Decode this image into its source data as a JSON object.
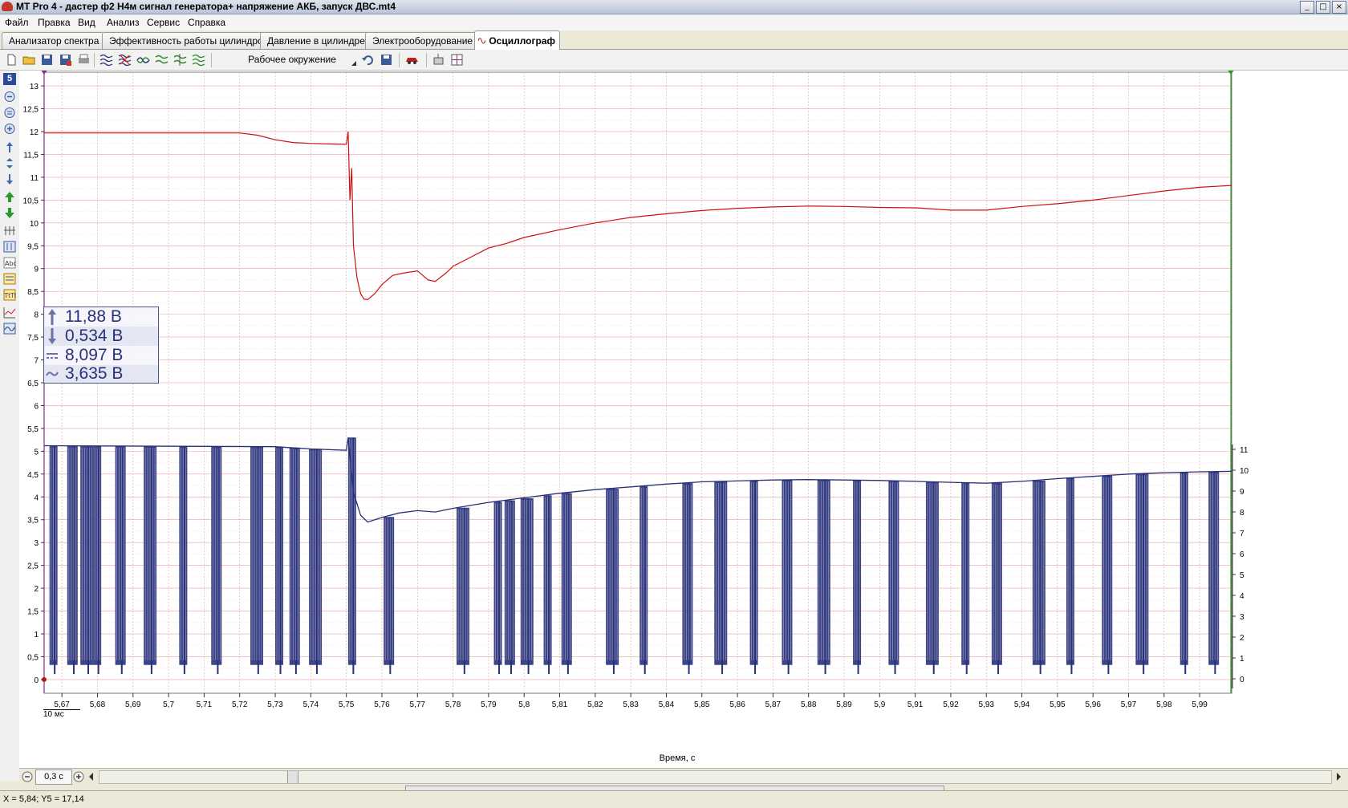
{
  "window": {
    "title": "MT Pro 4 - дастер ф2 Н4м сигнал генератора+ напряжение АКБ, запуск ДВС.mt4",
    "minimize": "_",
    "maximize": "□",
    "close": "×"
  },
  "menu": [
    "Файл",
    "Правка",
    "Вид",
    "Анализ",
    "Сервис",
    "Справка"
  ],
  "tabs": [
    {
      "label": "Анализатор спектра",
      "icon": "spectrum-icon",
      "active": false
    },
    {
      "label": "Эффективность работы цилиндров",
      "icon": "gears-icon",
      "active": false
    },
    {
      "label": "Давление в цилиндре",
      "icon": "pressure-icon",
      "active": false
    },
    {
      "label": "Электрооборудование",
      "icon": "electrical-icon",
      "active": false
    },
    {
      "label": "Осциллограф",
      "icon": "oscilloscope-icon",
      "active": true
    }
  ],
  "toolbar": {
    "workspace_label": "Рабочее окружение"
  },
  "left_toolbar": {
    "channel_badge": "5"
  },
  "measurements": [
    {
      "icon": "max-arrow-icon",
      "value": "11,88 В"
    },
    {
      "icon": "min-arrow-icon",
      "value": "0,534 В"
    },
    {
      "icon": "dc-average-icon",
      "value": "8,097 В"
    },
    {
      "icon": "ac-tilde-icon",
      "value": "3,635 В"
    }
  ],
  "bottom": {
    "scale_label": "10 мс",
    "zoom_value": "0,3 с",
    "status": "X = 5,84; Y5 = 17,14"
  },
  "chart_data": {
    "type": "line",
    "xlabel": "Время, с",
    "xlim": [
      5.665,
      5.999
    ],
    "x_ticks": [
      "5,67",
      "5,68",
      "5,69",
      "5,7",
      "5,71",
      "5,72",
      "5,73",
      "5,74",
      "5,75",
      "5,76",
      "5,77",
      "5,78",
      "5,79",
      "5,8",
      "5,81",
      "5,82",
      "5,83",
      "5,84",
      "5,85",
      "5,86",
      "5,87",
      "5,88",
      "5,89",
      "5,9",
      "5,91",
      "5,92",
      "5,93",
      "5,94",
      "5,95",
      "5,96",
      "5,97",
      "5,98",
      "5,99"
    ],
    "left_axis": {
      "ylim": [
        -0.3,
        13.3
      ],
      "ticks": [
        "0",
        "0,5",
        "1",
        "1,5",
        "2",
        "2,5",
        "3",
        "3,5",
        "4",
        "4,5",
        "5",
        "5,5",
        "6",
        "6,5",
        "7",
        "7,5",
        "8",
        "8,5",
        "9",
        "9,5",
        "10",
        "10,5",
        "11",
        "11,5",
        "12",
        "12,5",
        "13"
      ]
    },
    "right_axis": {
      "ticks": [
        "0",
        "1",
        "2",
        "3",
        "4",
        "5",
        "6",
        "7",
        "8",
        "9",
        "10",
        "11"
      ]
    },
    "grid": true,
    "colors": {
      "battery": "#cc1111",
      "generator": "#28307a",
      "grid": "#e8a0a0"
    },
    "series": [
      {
        "color": "#cc1111",
        "x": [
          5.665,
          5.72,
          5.725,
          5.73,
          5.735,
          5.74,
          5.75,
          5.7505,
          5.751,
          5.7515,
          5.752,
          5.753,
          5.754,
          5.755,
          5.756,
          5.758,
          5.76,
          5.763,
          5.766,
          5.77,
          5.773,
          5.775,
          5.778,
          5.78,
          5.785,
          5.79,
          5.795,
          5.8,
          5.81,
          5.82,
          5.83,
          5.84,
          5.85,
          5.86,
          5.87,
          5.88,
          5.89,
          5.9,
          5.91,
          5.92,
          5.93,
          5.94,
          5.95,
          5.96,
          5.97,
          5.98,
          5.99,
          5.999
        ],
        "y": [
          11.97,
          11.97,
          11.92,
          11.82,
          11.76,
          11.74,
          11.72,
          12.0,
          10.5,
          11.2,
          9.5,
          8.8,
          8.45,
          8.33,
          8.32,
          8.45,
          8.65,
          8.85,
          8.9,
          8.95,
          8.75,
          8.72,
          8.9,
          9.05,
          9.25,
          9.45,
          9.55,
          9.68,
          9.85,
          10.0,
          10.12,
          10.2,
          10.27,
          10.32,
          10.35,
          10.37,
          10.36,
          10.34,
          10.33,
          10.28,
          10.28,
          10.36,
          10.42,
          10.5,
          10.6,
          10.7,
          10.78,
          10.82
        ]
      },
      {
        "color": "#28307a",
        "x": [
          5.665,
          5.73,
          5.74,
          5.75,
          5.7505,
          5.751,
          5.752,
          5.754,
          5.756,
          5.76,
          5.765,
          5.77,
          5.775,
          5.78,
          5.79,
          5.8,
          5.81,
          5.82,
          5.83,
          5.84,
          5.85,
          5.86,
          5.87,
          5.88,
          5.89,
          5.9,
          5.91,
          5.92,
          5.93,
          5.94,
          5.95,
          5.96,
          5.97,
          5.98,
          5.99,
          5.999
        ],
        "y": [
          5.12,
          5.1,
          5.05,
          5.02,
          5.3,
          4.9,
          4.1,
          3.6,
          3.45,
          3.55,
          3.65,
          3.7,
          3.67,
          3.75,
          3.88,
          3.98,
          4.08,
          4.16,
          4.22,
          4.28,
          4.33,
          4.35,
          4.37,
          4.38,
          4.37,
          4.36,
          4.34,
          4.32,
          4.3,
          4.34,
          4.4,
          4.45,
          4.5,
          4.53,
          4.55,
          4.56
        ]
      }
    ],
    "generator_pulses_x": [
      5.6665,
      5.6715,
      5.6752,
      5.6788,
      5.685,
      5.693,
      5.703,
      5.712,
      5.723,
      5.73,
      5.734,
      5.7395,
      5.7505,
      5.7605,
      5.781,
      5.7915,
      5.7945,
      5.799,
      5.8055,
      5.8105,
      5.823,
      5.8325,
      5.8445,
      5.8535,
      5.8635,
      5.8725,
      5.8825,
      5.8925,
      5.9025,
      5.913,
      5.923,
      5.9315,
      5.943,
      5.9525,
      5.9625,
      5.972,
      5.9845,
      5.9925
    ]
  }
}
